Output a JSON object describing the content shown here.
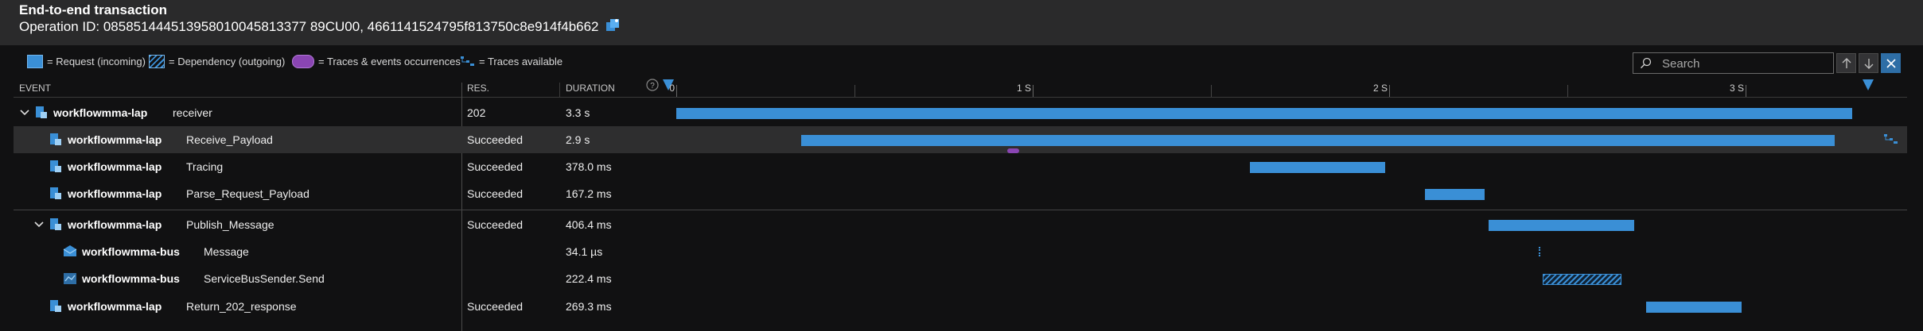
{
  "header": {
    "title": "End-to-end transaction",
    "operation_id": "Operation ID: 085851444513958010045813377 89CU00, 4661141524795f813750c8e914f4b662"
  },
  "legend": {
    "request": "= Request (incoming)",
    "dependency": "= Dependency (outgoing)",
    "traces": "= Traces & events occurrences",
    "traces_available": "= Traces available"
  },
  "search": {
    "placeholder": "Search"
  },
  "columns": {
    "event": "EVENT",
    "result": "RES.",
    "duration": "DURATION"
  },
  "timeline": {
    "ticks": [
      "0",
      "1 S",
      "2 S",
      "3 S"
    ]
  },
  "rows": [
    {
      "app": "workflowmma-lap",
      "name": "receiver",
      "result": "202",
      "duration": "3.3 s",
      "start_s": 0.0,
      "duration_s": 3.3,
      "kind": "request"
    },
    {
      "app": "workflowmma-lap",
      "name": "Receive_Payload",
      "result": "Succeeded",
      "duration": "2.9 s",
      "start_s": 0.35,
      "duration_s": 2.9,
      "kind": "request"
    },
    {
      "app": "workflowmma-lap",
      "name": "Tracing",
      "result": "Succeeded",
      "duration": "378.0 ms",
      "start_s": 1.61,
      "duration_s": 0.378,
      "kind": "request"
    },
    {
      "app": "workflowmma-lap",
      "name": "Parse_Request_Payload",
      "result": "Succeeded",
      "duration": "167.2 ms",
      "start_s": 2.1,
      "duration_s": 0.1672,
      "kind": "request"
    },
    {
      "app": "workflowmma-lap",
      "name": "Publish_Message",
      "result": "Succeeded",
      "duration": "406.4 ms",
      "start_s": 2.28,
      "duration_s": 0.4064,
      "kind": "request"
    },
    {
      "app": "workflowmma-bus",
      "name": "Message",
      "result": "",
      "duration": "34.1 µs",
      "start_s": 2.42,
      "duration_s": 3.41e-05,
      "kind": "tiny"
    },
    {
      "app": "workflowmma-bus",
      "name": "ServiceBusSender.Send",
      "result": "",
      "duration": "222.4 ms",
      "start_s": 2.43,
      "duration_s": 0.2224,
      "kind": "dependency"
    },
    {
      "app": "workflowmma-lap",
      "name": "Return_202_response",
      "result": "Succeeded",
      "duration": "269.3 ms",
      "start_s": 2.72,
      "duration_s": 0.2693,
      "kind": "request"
    }
  ],
  "colors": {
    "bar": "#3a8fd6",
    "trace": "#8a45b3",
    "accent": "#2e6ea6"
  }
}
